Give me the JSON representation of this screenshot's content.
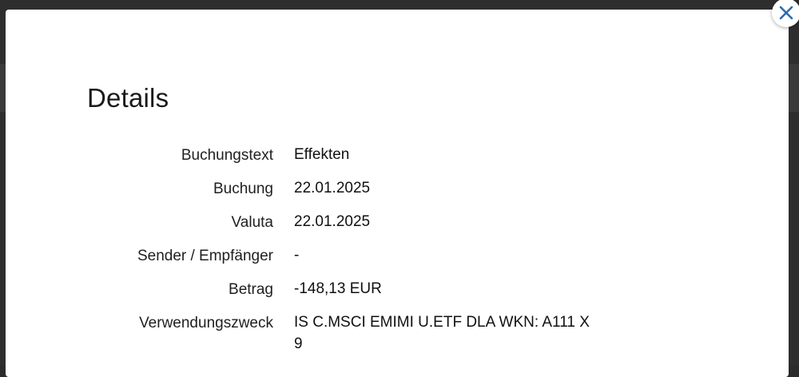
{
  "modal": {
    "title": "Details",
    "close_icon": "close-icon",
    "accent_color": "#2b6cb0"
  },
  "details": [
    {
      "label": "Buchungstext",
      "value": "Effekten"
    },
    {
      "label": "Buchung",
      "value": "22.01.2025"
    },
    {
      "label": "Valuta",
      "value": "22.01.2025"
    },
    {
      "label": "Sender / Empfänger",
      "value": "-"
    },
    {
      "label": "Betrag",
      "value": "-148,13 EUR"
    },
    {
      "label": "Verwendungszweck",
      "value": "IS C.MSCI EMIMI U.ETF DLA WKN: A111 X9"
    }
  ]
}
